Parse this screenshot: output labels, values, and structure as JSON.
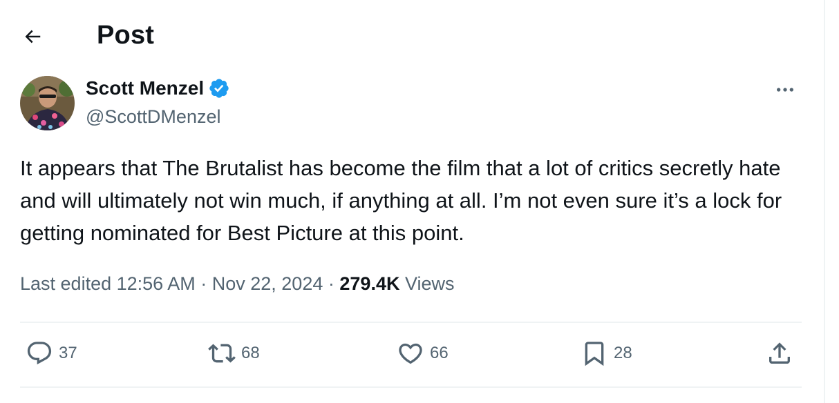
{
  "header": {
    "title": "Post",
    "back_icon": "arrow-left-icon"
  },
  "author": {
    "name": "Scott Menzel",
    "handle": "@ScottDMenzel",
    "verified": true,
    "verified_color": "#1d9bf0"
  },
  "tweet": {
    "text": "It appears that The Brutalist has become the film that a lot of critics secretly hate and will ultimately not win much, if anything at all. I’m not even sure it’s a lock for getting nominated for Best Picture at this point.",
    "edited_label": "Last edited",
    "time": "12:56 AM",
    "separator": "·",
    "date": "Nov 22, 2024",
    "views_count": "279.4K",
    "views_label": "Views"
  },
  "actions": {
    "replies": "37",
    "reposts": "68",
    "likes": "66",
    "bookmarks": "28"
  },
  "colors": {
    "text_primary": "#0f1419",
    "text_secondary": "#536471",
    "border": "#eff3f4"
  }
}
